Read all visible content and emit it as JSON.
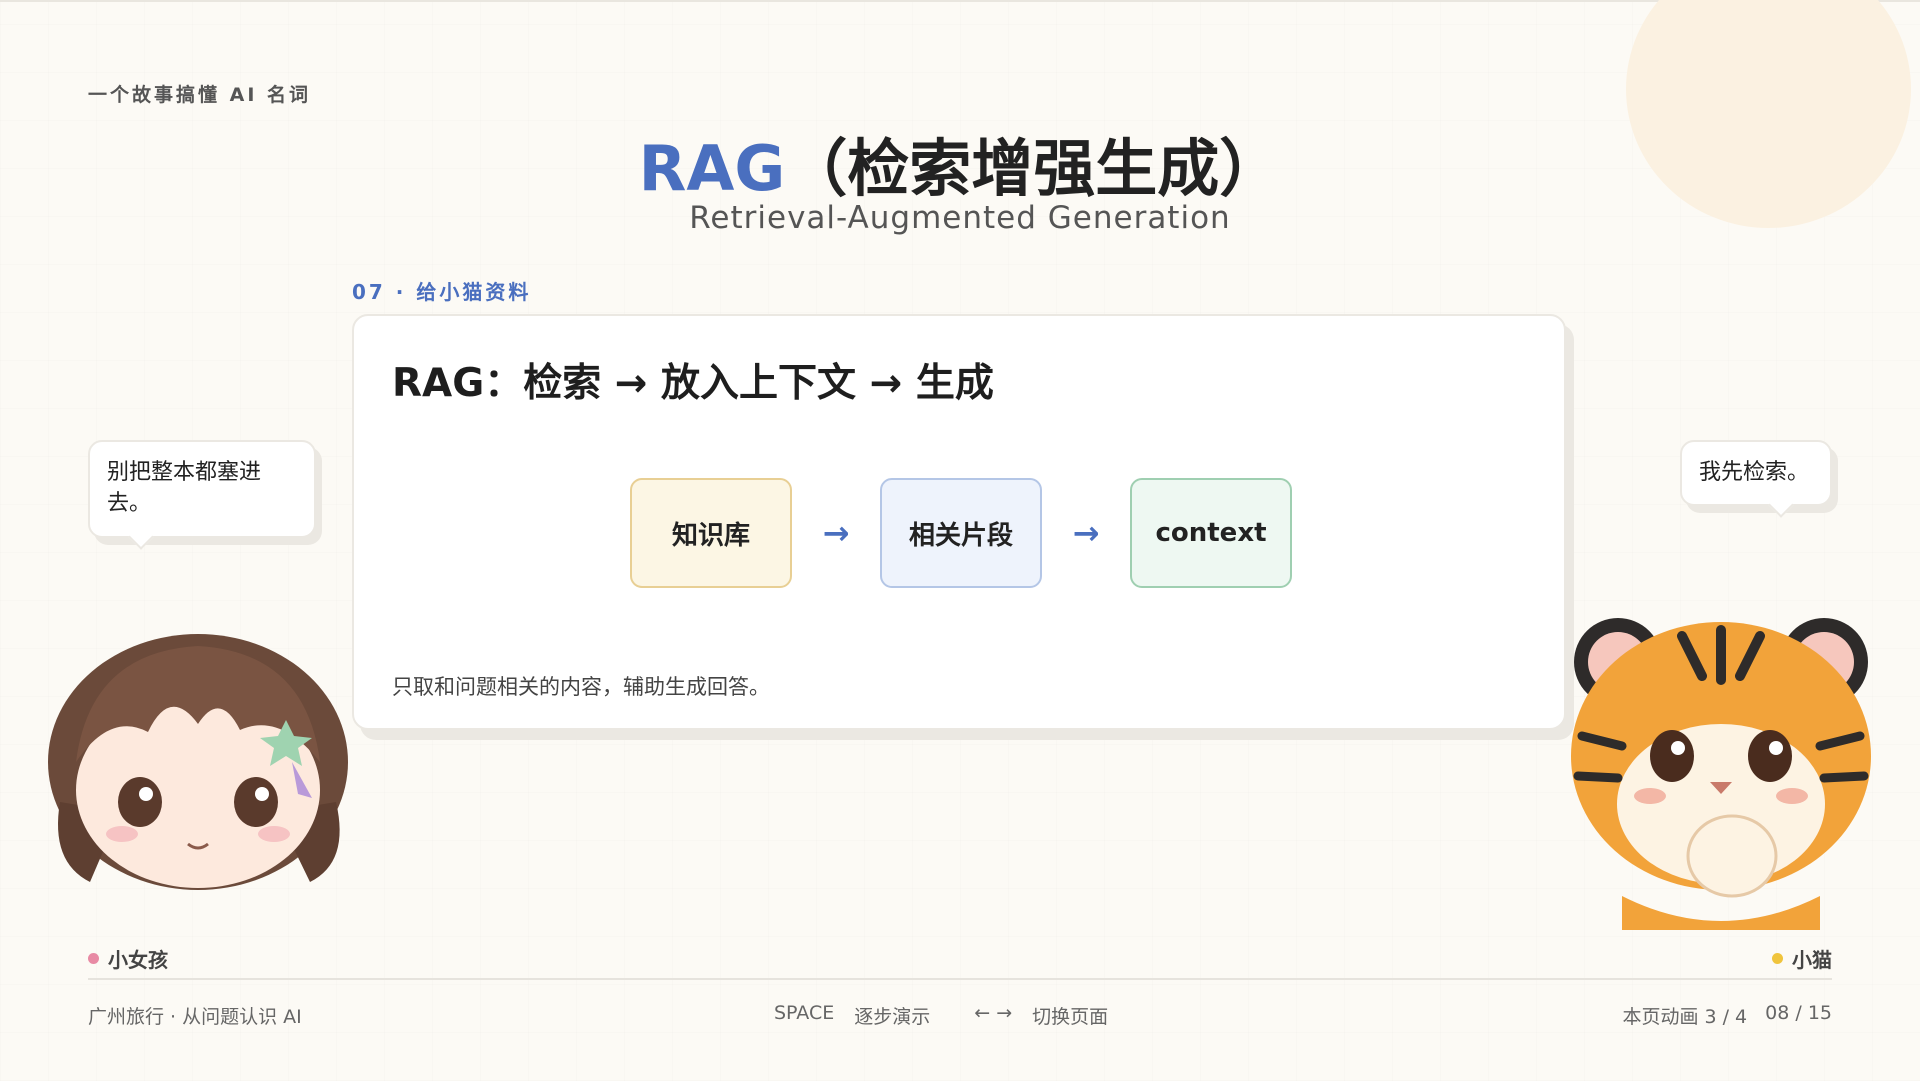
{
  "header": {
    "series_label": "一个故事搞懂 AI 名词",
    "title_accent": "RAG",
    "title_rest": "（检索增强生成）",
    "subtitle": "Retrieval-Augmented Generation"
  },
  "section": {
    "label": "07 · 给小猫资料"
  },
  "card": {
    "heading": "RAG：检索 → 放入上下文 → 生成",
    "flow": [
      {
        "label": "知识库",
        "arrow": "→"
      },
      {
        "label": "相关片段",
        "arrow": "→"
      },
      {
        "label": "context",
        "arrow": ""
      }
    ],
    "note": "只取和问题相关的内容，辅助生成回答。"
  },
  "bubbles": {
    "left": "别把整本都塞进去。",
    "right": "我先检索。"
  },
  "characters": {
    "girl": {
      "label": "小女孩",
      "dot_color": "#e88aa4",
      "icon": "girl-avatar"
    },
    "cat": {
      "label": "小猫",
      "dot_color": "#f0c43c",
      "icon": "tiger-cat-avatar"
    }
  },
  "footer": {
    "left": "广州旅行 · 从问题认识 AI",
    "space_key": "SPACE",
    "space_action": "逐步演示",
    "arrow_keys": "←  →",
    "arrow_action": "切换页面",
    "anim_progress": "本页动画 3 / 4",
    "page_progress": "08 / 15"
  },
  "colors": {
    "accent": "#4a6fbf",
    "background": "#fcfaf5"
  }
}
